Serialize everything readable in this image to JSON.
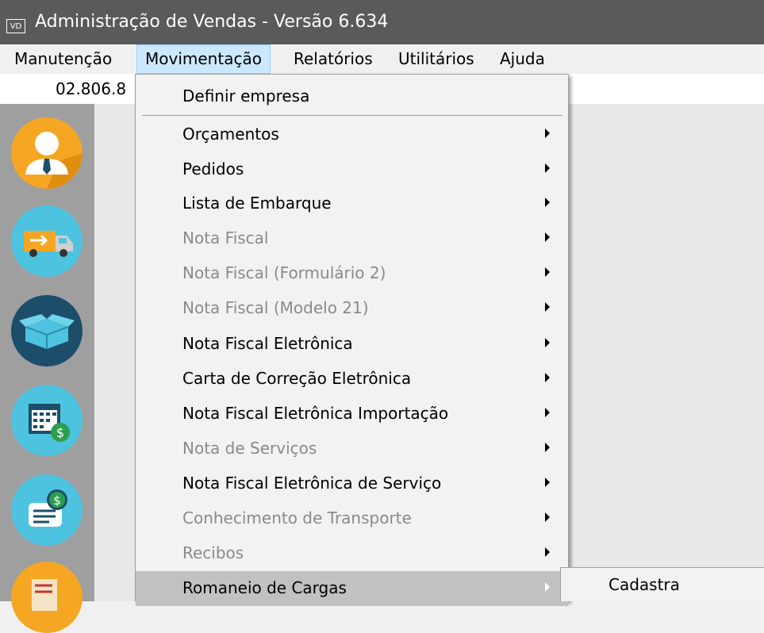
{
  "window": {
    "icon_label": "VD",
    "title": "Administração de Vendas - Versão 6.634"
  },
  "menubar": {
    "items": [
      {
        "label": "Manutenção"
      },
      {
        "label": "Movimentação",
        "active": true
      },
      {
        "label": "Relatórios"
      },
      {
        "label": "Utilitários"
      },
      {
        "label": "Ajuda"
      }
    ]
  },
  "infobar": {
    "code": "02.806.8"
  },
  "sidebar": {
    "buttons": [
      {
        "icon": "user-icon",
        "color": "#f5a623"
      },
      {
        "icon": "delivery-truck-icon",
        "color": "#4ec3e0"
      },
      {
        "icon": "box-icon",
        "color": "#1c4e6a"
      },
      {
        "icon": "calendar-money-icon",
        "color": "#4ec3e0"
      },
      {
        "icon": "invoice-money-icon",
        "color": "#4ec3e0"
      },
      {
        "icon": "document-scroll-icon",
        "color": "#f5a623"
      }
    ]
  },
  "menu": {
    "header_item": "Definir empresa",
    "items": [
      {
        "label": "Orçamentos",
        "enabled": true,
        "has_submenu": true
      },
      {
        "label": "Pedidos",
        "enabled": true,
        "has_submenu": true
      },
      {
        "label": "Lista de Embarque",
        "enabled": true,
        "has_submenu": true
      },
      {
        "label": "Nota Fiscal",
        "enabled": false,
        "has_submenu": true
      },
      {
        "label": "Nota Fiscal (Formulário 2)",
        "enabled": false,
        "has_submenu": true
      },
      {
        "label": "Nota Fiscal (Modelo 21)",
        "enabled": false,
        "has_submenu": true
      },
      {
        "label": "Nota Fiscal Eletrônica",
        "enabled": true,
        "has_submenu": true
      },
      {
        "label": "Carta de Correção Eletrônica",
        "enabled": true,
        "has_submenu": true
      },
      {
        "label": "Nota Fiscal Eletrônica Importação",
        "enabled": true,
        "has_submenu": true
      },
      {
        "label": "Nota de Serviços",
        "enabled": false,
        "has_submenu": true
      },
      {
        "label": "Nota Fiscal Eletrônica de Serviço",
        "enabled": true,
        "has_submenu": true
      },
      {
        "label": "Conhecimento de Transporte",
        "enabled": false,
        "has_submenu": true
      },
      {
        "label": "Recibos",
        "enabled": false,
        "has_submenu": true
      },
      {
        "label": "Romaneio de Cargas",
        "enabled": true,
        "has_submenu": true,
        "highlighted": true
      }
    ]
  },
  "submenu": {
    "items": [
      {
        "label": "Cadastra"
      }
    ]
  }
}
